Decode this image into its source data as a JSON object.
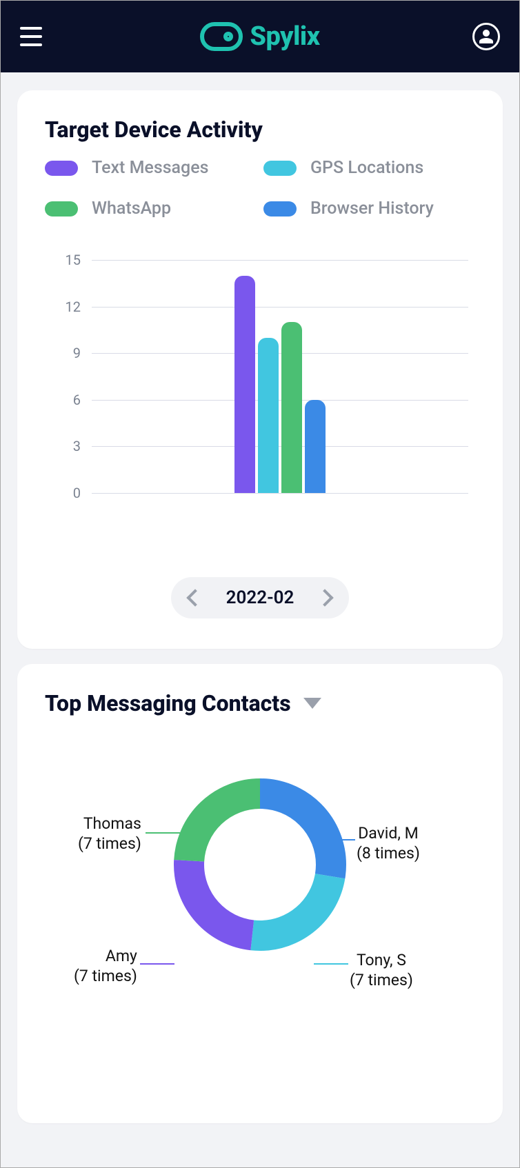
{
  "brand": {
    "name": "Spylix"
  },
  "colors": {
    "text_messages": "#7a57ed",
    "gps": "#41c6e0",
    "whatsapp": "#4bbf73",
    "browser": "#3b8ae6"
  },
  "activity_card": {
    "title": "Target Device Activity",
    "legend": {
      "text_messages": "Text Messages",
      "gps": "GPS Locations",
      "whatsapp": "WhatsApp",
      "browser": "Browser History"
    },
    "date": "2022-02"
  },
  "contacts_card": {
    "title": "Top Messaging Contacts",
    "labels": {
      "david": "David, M",
      "david_sub": "(8 times)",
      "tony": "Tony, S",
      "tony_sub": "(7 times)",
      "amy": "Amy",
      "amy_sub": "(7 times)",
      "thomas": "Thomas",
      "thomas_sub": "(7 times)"
    }
  },
  "chart_data": [
    {
      "type": "bar",
      "title": "Target Device Activity",
      "categories": [
        "Text Messages",
        "GPS Locations",
        "WhatsApp",
        "Browser History"
      ],
      "values": [
        14,
        10,
        11,
        6
      ],
      "ylabel": "",
      "xlabel": "",
      "ylim": [
        0,
        15
      ],
      "yticks": [
        0,
        3,
        6,
        9,
        12,
        15
      ],
      "colors": [
        "#7a57ed",
        "#41c6e0",
        "#4bbf73",
        "#3b8ae6"
      ]
    },
    {
      "type": "pie",
      "title": "Top Messaging Contacts",
      "series": [
        {
          "name": "David, M",
          "value": 8,
          "color": "#3b8ae6"
        },
        {
          "name": "Tony, S",
          "value": 7,
          "color": "#41c6e0"
        },
        {
          "name": "Amy",
          "value": 7,
          "color": "#7a57ed"
        },
        {
          "name": "Thomas",
          "value": 7,
          "color": "#4bbf73"
        }
      ]
    }
  ]
}
